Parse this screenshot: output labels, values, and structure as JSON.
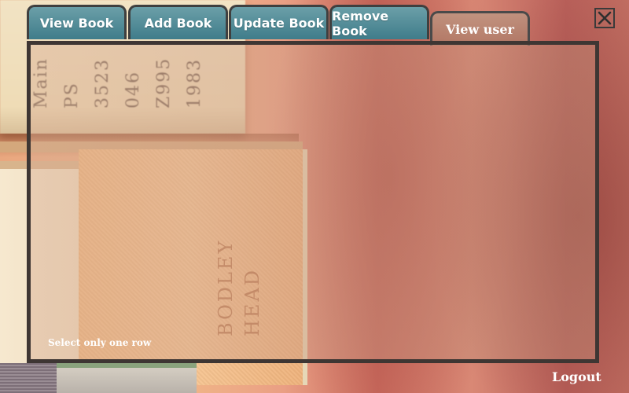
{
  "tabs": [
    {
      "label": "View Book"
    },
    {
      "label": "Add Book"
    },
    {
      "label": "Update Book"
    },
    {
      "label": "Remove Book"
    },
    {
      "label": "View user",
      "active": true
    }
  ],
  "panel": {
    "hint": "Select only one row"
  },
  "window": {
    "close_icon": "close-icon"
  },
  "footer": {
    "logout_label": "Logout"
  },
  "background": {
    "spine_lines": [
      "Main",
      "PS",
      "3523",
      "046",
      "Z995",
      "1983"
    ],
    "spine_imprint": [
      "BODLEY",
      "HEAD"
    ]
  },
  "colors": {
    "tab_fill": "#3f7c8a",
    "active_tab_fill": "#b98e7c",
    "border": "#3e3633",
    "text": "#ffffff"
  }
}
